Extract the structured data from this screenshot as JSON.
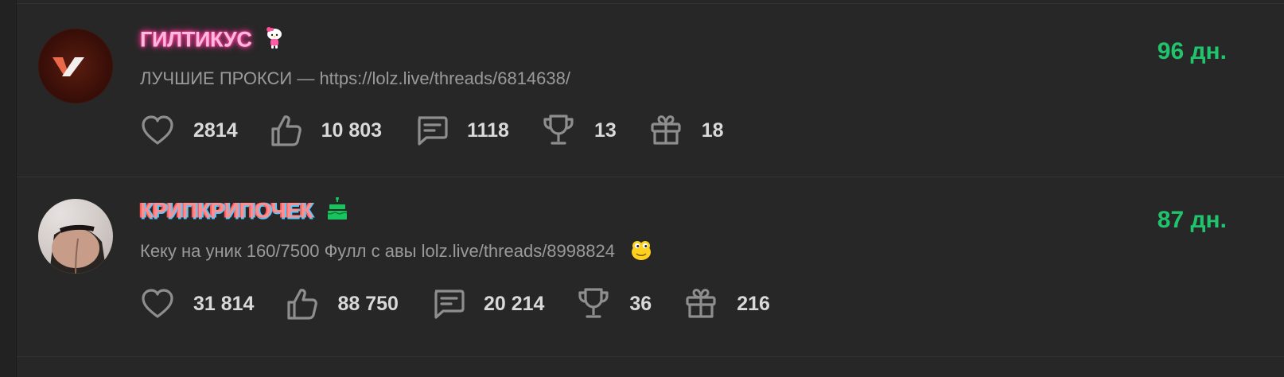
{
  "users": [
    {
      "name": "ГИЛТИКУС",
      "avatar_text": "VP",
      "name_icon": "hello-kitty-icon",
      "status": "ЛУЧШИЕ ПРОКСИ — https://lolz.live/threads/6814638/",
      "days": "96 дн.",
      "stats": {
        "likes": "2814",
        "thumbs": "10 803",
        "messages": "1118",
        "trophies": "13",
        "gifts": "18"
      }
    },
    {
      "name": "КРИПКРИПОЧЕК",
      "name_icon": "cake-icon",
      "status": "Кеку на уник 160/7500 Фулл с авы lolz.live/threads/8998824",
      "status_emoji": "yellow-blob-emoji",
      "days": "87 дн.",
      "stats": {
        "likes": "31 814",
        "thumbs": "88 750",
        "messages": "20 214",
        "trophies": "36",
        "gifts": "216"
      }
    }
  ],
  "colors": {
    "background": "#272727",
    "days_green": "#1fc46d",
    "status_gray": "#9a9a9a",
    "stat_text": "#d9d9d9",
    "icon_gray": "#8e8e8e"
  }
}
